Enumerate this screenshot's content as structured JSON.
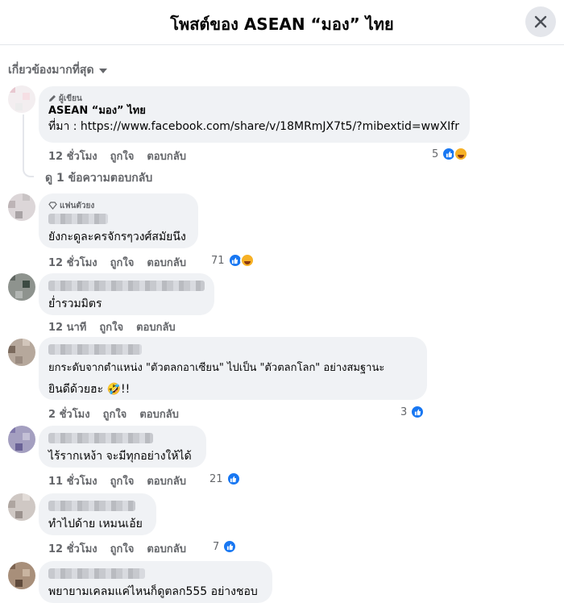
{
  "header": {
    "title": "โพสต์ของ ASEAN “มอง” ไทย"
  },
  "sort": {
    "label": "เกี่ยวข้องมากที่สุด"
  },
  "comments": [
    {
      "badge": "ผู้เขียน",
      "author": "ASEAN “มอง” ไทย",
      "text": "ที่มา : https://www.facebook.com/share/v/18MRmJX7t5/?mibextid=wwXIfr",
      "time": "12 ชั่วโมง",
      "like": "ถูกใจ",
      "reply": "ตอบกลับ",
      "reactions": "5",
      "view_replies": "ดู 1 ข้อความตอบกลับ"
    },
    {
      "badge": "แฟนตัวยง",
      "text": "ยังกะดูละครจักรๆวงศ์สมัยนึง",
      "time": "12 ชั่วโมง",
      "like": "ถูกใจ",
      "reply": "ตอบกลับ",
      "reactions": "71"
    },
    {
      "text": "ย่ำรวมมิตร",
      "time": "12 นาที",
      "like": "ถูกใจ",
      "reply": "ตอบกลับ"
    },
    {
      "text_line1": "ยกระดับจากตำแหน่ง \"ตัวตลกอาเซียน\" ไปเป็น \"ตัวตลกโลก\" อย่างสมฐานะ",
      "text_line2": "ยินดีด้วยฮะ 🤣!!",
      "time": "2 ชั่วโมง",
      "like": "ถูกใจ",
      "reply": "ตอบกลับ",
      "reactions": "3"
    },
    {
      "text": "ไร้รากเหง้า จะมีทุกอย่างให้ได้",
      "time": "11 ชั่วโมง",
      "like": "ถูกใจ",
      "reply": "ตอบกลับ",
      "reactions": "21"
    },
    {
      "text": "ทำไปด้าย เหมนเอ้ย",
      "time": "12 ชั่วโมง",
      "like": "ถูกใจ",
      "reply": "ตอบกลับ",
      "reactions": "7"
    },
    {
      "text": "พยายามเคลมแค่ไหนก็ดูตลก555 อย่างชอบ"
    }
  ],
  "icons": {
    "close": "close-icon",
    "like": "like-reaction-icon",
    "haha": "haha-reaction-icon",
    "pencil": "pencil-icon",
    "diamond": "diamond-icon"
  },
  "colors": {
    "accent": "#1877f2",
    "bubble": "#f0f2f5",
    "muted": "#65676b"
  }
}
